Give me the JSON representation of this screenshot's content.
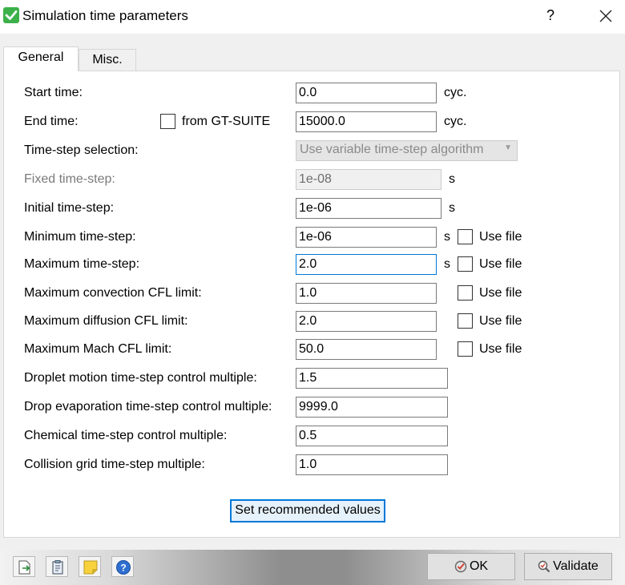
{
  "window": {
    "title": "Simulation time parameters",
    "help": "?"
  },
  "tabs": [
    {
      "label": "General",
      "active": true
    },
    {
      "label": "Misc.",
      "active": false
    }
  ],
  "form": {
    "start_time": {
      "label": "Start time:",
      "value": "0.0",
      "unit": "cyc."
    },
    "end_time": {
      "label": "End time:",
      "from_label": "from GT-SUITE",
      "from_checked": false,
      "value": "15000.0",
      "unit": "cyc."
    },
    "timestep_selection": {
      "label": "Time-step selection:",
      "value": "Use variable time-step algorithm"
    },
    "fixed_timestep": {
      "label": "Fixed time-step:",
      "value": "1e-08",
      "unit": "s",
      "disabled": true
    },
    "initial_timestep": {
      "label": "Initial time-step:",
      "value": "1e-06",
      "unit": "s"
    },
    "minimum_timestep": {
      "label": "Minimum time-step:",
      "value": "1e-06",
      "unit": "s",
      "use_file": "Use file"
    },
    "maximum_timestep": {
      "label": "Maximum time-step:",
      "value": "2.0",
      "unit": "s",
      "use_file": "Use file"
    },
    "max_convection_cfl": {
      "label": "Maximum convection CFL limit:",
      "value": "1.0",
      "use_file": "Use file"
    },
    "max_diffusion_cfl": {
      "label": "Maximum diffusion CFL limit:",
      "value": "2.0",
      "use_file": "Use file"
    },
    "max_mach_cfl": {
      "label": "Maximum Mach CFL limit:",
      "value": "50.0",
      "use_file": "Use file"
    },
    "droplet_motion": {
      "label": "Droplet motion time-step control multiple:",
      "value": "1.5"
    },
    "drop_evaporation": {
      "label": "Drop evaporation time-step control multiple:",
      "value": "9999.0"
    },
    "chemical": {
      "label": "Chemical time-step control multiple:",
      "value": "0.5"
    },
    "collision_grid": {
      "label": "Collision grid time-step multiple:",
      "value": "1.0"
    }
  },
  "buttons": {
    "recommended": "Set recommended values",
    "ok": "OK",
    "validate": "Validate"
  },
  "colors": {
    "accent": "#0078d7",
    "check_green": "#3cb14a",
    "note_yellow": "#f7d23c",
    "help_blue": "#2f6fd0"
  }
}
